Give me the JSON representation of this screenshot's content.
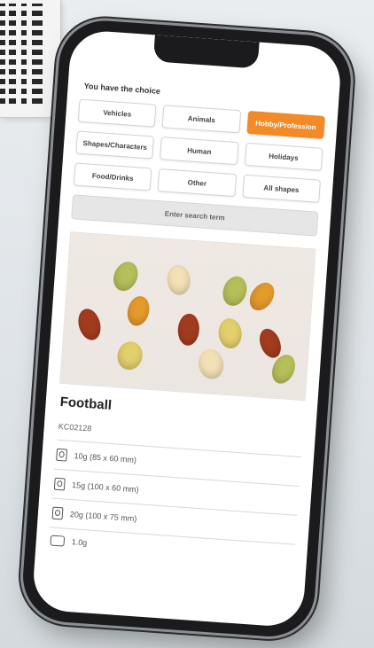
{
  "filter": {
    "title": "You have the choice",
    "categories": [
      {
        "label": "Vehicles",
        "active": false
      },
      {
        "label": "Animals",
        "active": false
      },
      {
        "label": "Hobby/Profession",
        "active": true
      },
      {
        "label": "Shapes/Characters",
        "active": false
      },
      {
        "label": "Human",
        "active": false
      },
      {
        "label": "Holidays",
        "active": false
      },
      {
        "label": "Food/Drinks",
        "active": false
      },
      {
        "label": "Other",
        "active": false
      },
      {
        "label": "All shapes",
        "active": false
      }
    ],
    "search_label": "Enter search term"
  },
  "product": {
    "name": "Football",
    "sku": "KC02128",
    "variants": [
      {
        "text": "10g (85 x 60 mm)"
      },
      {
        "text": "15g (100 x 60 mm)"
      },
      {
        "text": "20g (100 x 75 mm)"
      }
    ],
    "extra_weight": "1.0g"
  },
  "colors": {
    "accent": "#f28a27",
    "gummy_red": "#a33c1f",
    "gummy_orange": "#e49a2c",
    "gummy_yellow": "#e3cf6c",
    "gummy_green": "#b7bf5a",
    "gummy_cream": "#f2e0b7"
  }
}
